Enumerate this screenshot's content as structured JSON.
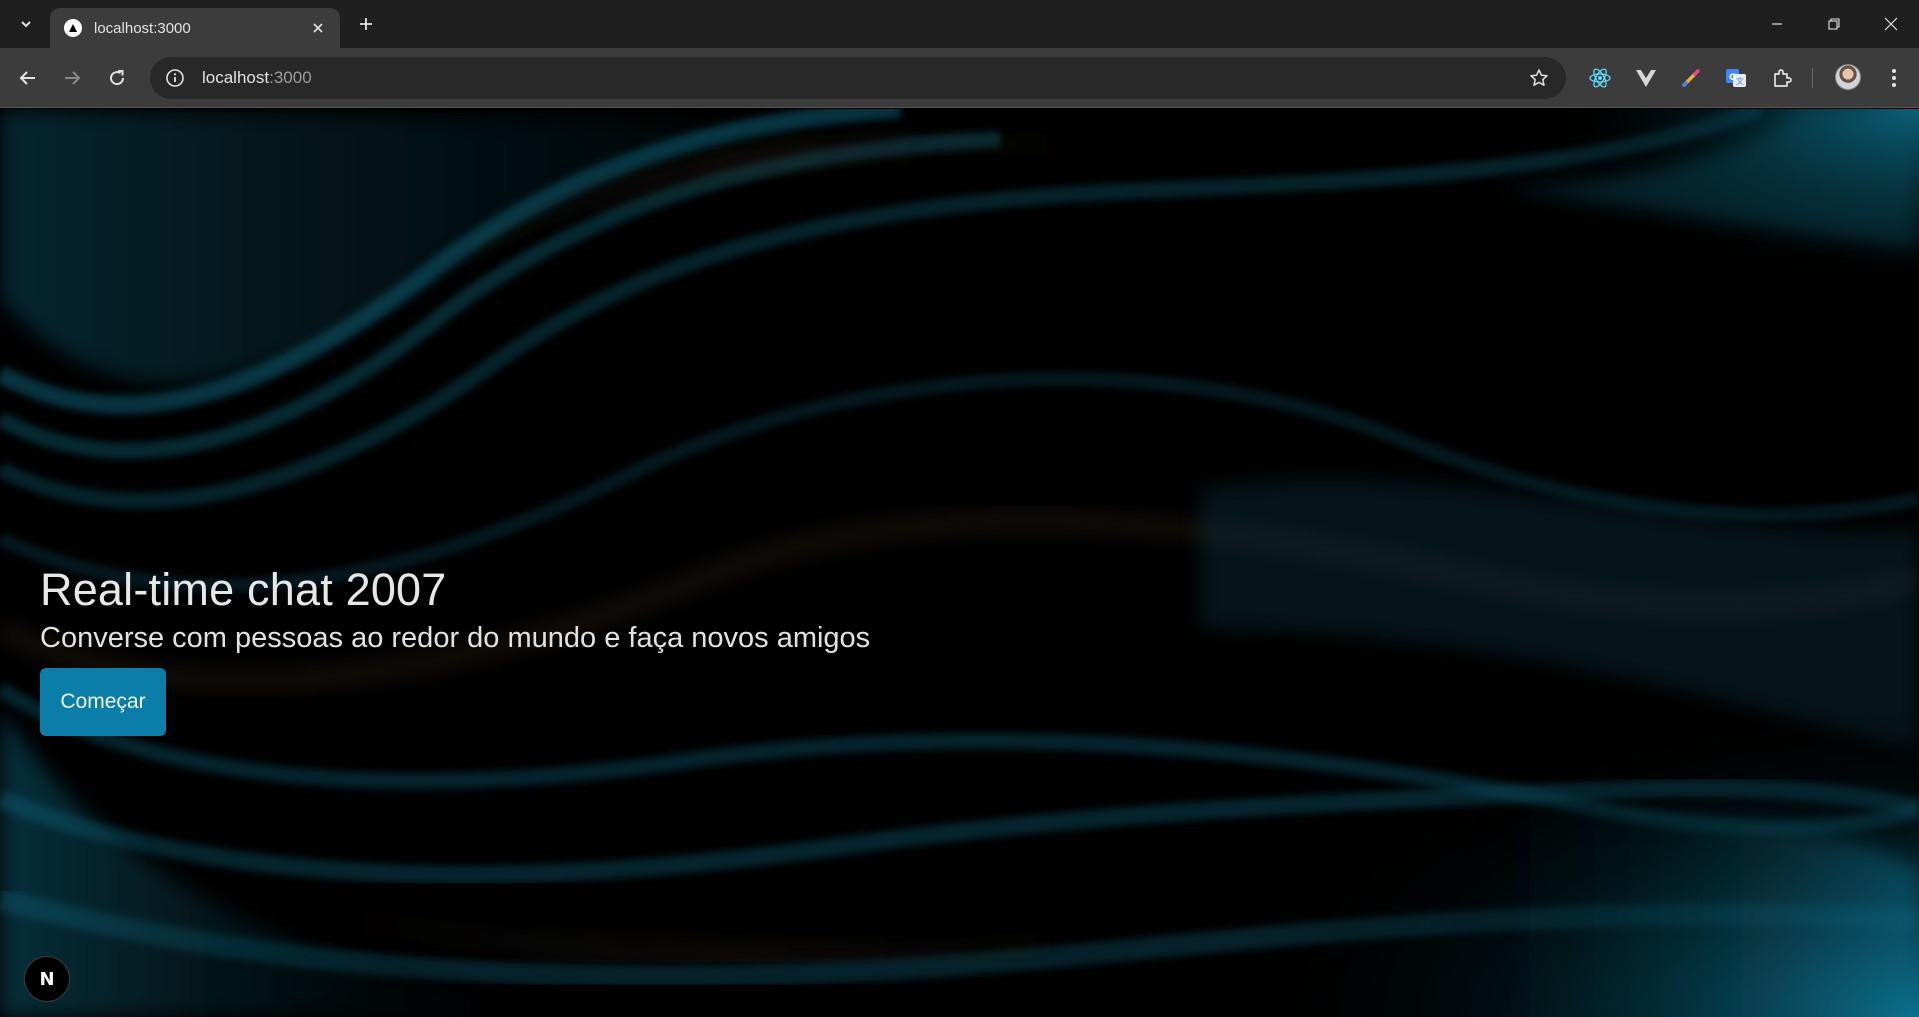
{
  "browser": {
    "tab": {
      "title": "localhost:3000"
    },
    "address_bar": {
      "host": "localhost",
      "port": ":3000"
    },
    "extensions": [
      "react-devtools-icon",
      "vue-devtools-icon",
      "color-picker-icon",
      "google-translate-icon",
      "extensions-puzzle-icon"
    ]
  },
  "page": {
    "title": "Real-time chat 2007",
    "subtitle": "Converse com pessoas ao redor do mundo e faça novos amigos",
    "cta_label": "Começar",
    "dev_badge": "N"
  },
  "colors": {
    "button": "#0a7ea8",
    "wave_teal": "#0b6a86",
    "wave_brown": "#3b2a1a",
    "background": "#000000"
  }
}
